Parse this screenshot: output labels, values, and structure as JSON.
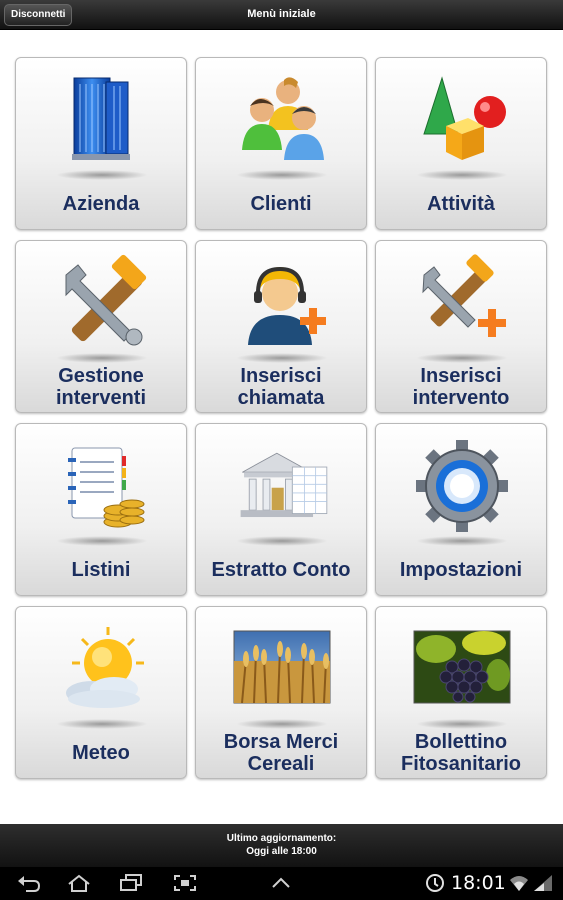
{
  "header": {
    "disconnect_label": "Disconnetti",
    "title": "Menù iniziale"
  },
  "menu": [
    {
      "label": "Azienda",
      "icon": "building-icon"
    },
    {
      "label": "Clienti",
      "icon": "people-icon"
    },
    {
      "label": "Attività",
      "icon": "shapes-icon"
    },
    {
      "label": "Gestione\ninterventi",
      "icon": "tools-icon"
    },
    {
      "label": "Inserisci\nchiamata",
      "icon": "operator-add-icon"
    },
    {
      "label": "Inserisci\nintervento",
      "icon": "tools-add-icon"
    },
    {
      "label": "Listini",
      "icon": "pricelist-icon"
    },
    {
      "label": "Estratto Conto",
      "icon": "bank-icon"
    },
    {
      "label": "Impostazioni",
      "icon": "gear-icon"
    },
    {
      "label": "Meteo",
      "icon": "weather-icon"
    },
    {
      "label": "Borsa Merci\nCereali",
      "icon": "wheat-icon"
    },
    {
      "label": "Bollettino\nFitosanitario",
      "icon": "grapes-icon"
    }
  ],
  "footer": {
    "line1": "Ultimo aggiornamento:",
    "line2": "Oggi alle 18:00"
  },
  "system_bar": {
    "time": "18:01"
  },
  "colors": {
    "label": "#1b2e5e",
    "bar": "#1a1a1a"
  }
}
